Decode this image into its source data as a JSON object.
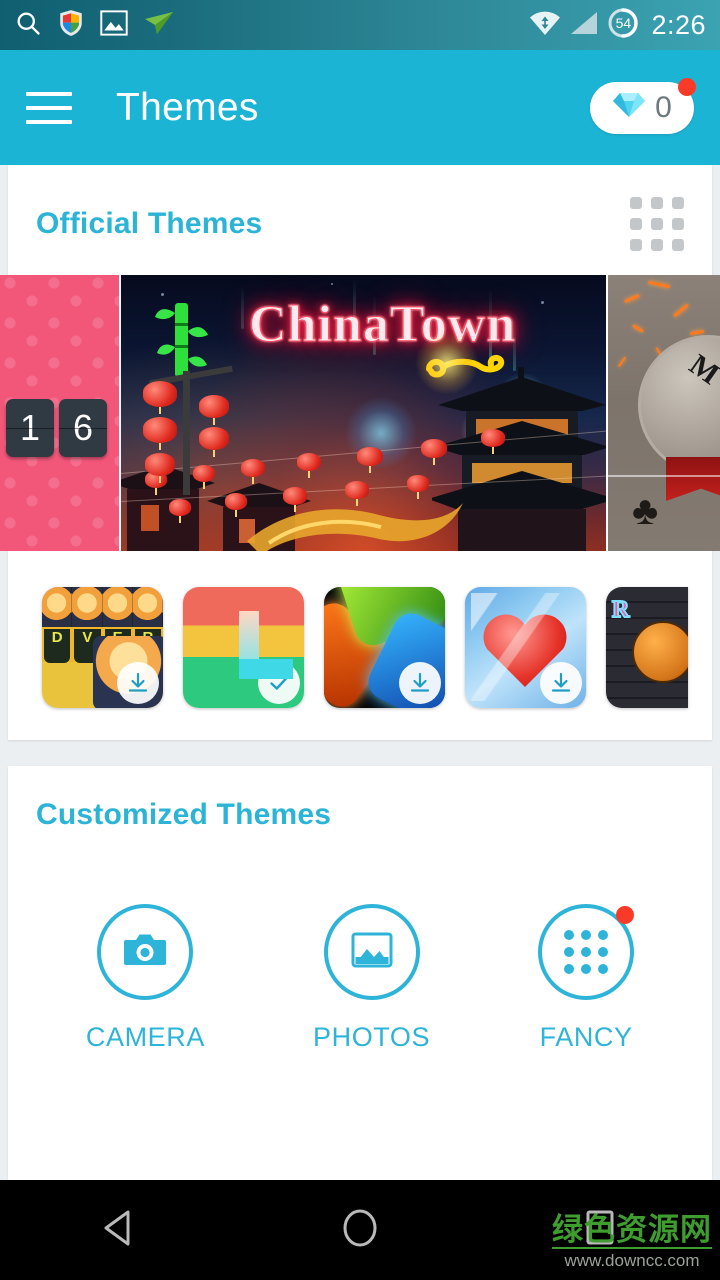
{
  "statusbar": {
    "time": "2:26",
    "battery_percent": "54",
    "icons": [
      "search-icon",
      "security-shield-icon",
      "gallery-icon",
      "paper-plane-icon",
      "wifi-icon",
      "signal-icon",
      "battery-icon"
    ]
  },
  "appbar": {
    "title": "Themes",
    "menu_icon": "hamburger-menu-icon",
    "gem_count": "0",
    "gem_icon": "diamond-icon",
    "has_badge": true,
    "background_color": "#1cb4d4"
  },
  "official": {
    "title": "Official Themes",
    "grid_icon": "grid-view-icon",
    "banners": [
      {
        "name": "pink-hearts-clock-theme",
        "clock_digits": [
          "1",
          "6"
        ]
      },
      {
        "name": "chinatown-theme",
        "label": "ChinaTown"
      },
      {
        "name": "medal-stone-theme",
        "label": "M"
      }
    ],
    "thumbnails": [
      {
        "name": "trump-theme",
        "state": "download",
        "state_icon": "download-icon"
      },
      {
        "name": "colorful-l-theme",
        "state": "installed",
        "state_icon": "check-icon"
      },
      {
        "name": "neon-shapes-theme",
        "state": "download",
        "state_icon": "download-icon"
      },
      {
        "name": "ice-heart-theme",
        "state": "download",
        "state_icon": "download-icon"
      },
      {
        "name": "graffiti-basketball-theme",
        "state": "none",
        "state_icon": ""
      }
    ]
  },
  "customized": {
    "title": "Customized Themes",
    "items": [
      {
        "label": "CAMERA",
        "icon": "camera-icon",
        "badge": false
      },
      {
        "label": "PHOTOS",
        "icon": "photo-icon",
        "badge": false
      },
      {
        "label": "FANCY",
        "icon": "app-grid-icon",
        "badge": true
      }
    ],
    "accent_color": "#2eb4d8"
  },
  "navbar": {
    "back_icon": "back-triangle-icon",
    "home_icon": "home-circle-icon",
    "recents_icon": "recents-square-icon",
    "watermark_cn": "绿色资源网",
    "watermark_url": "www.downcc.com"
  }
}
